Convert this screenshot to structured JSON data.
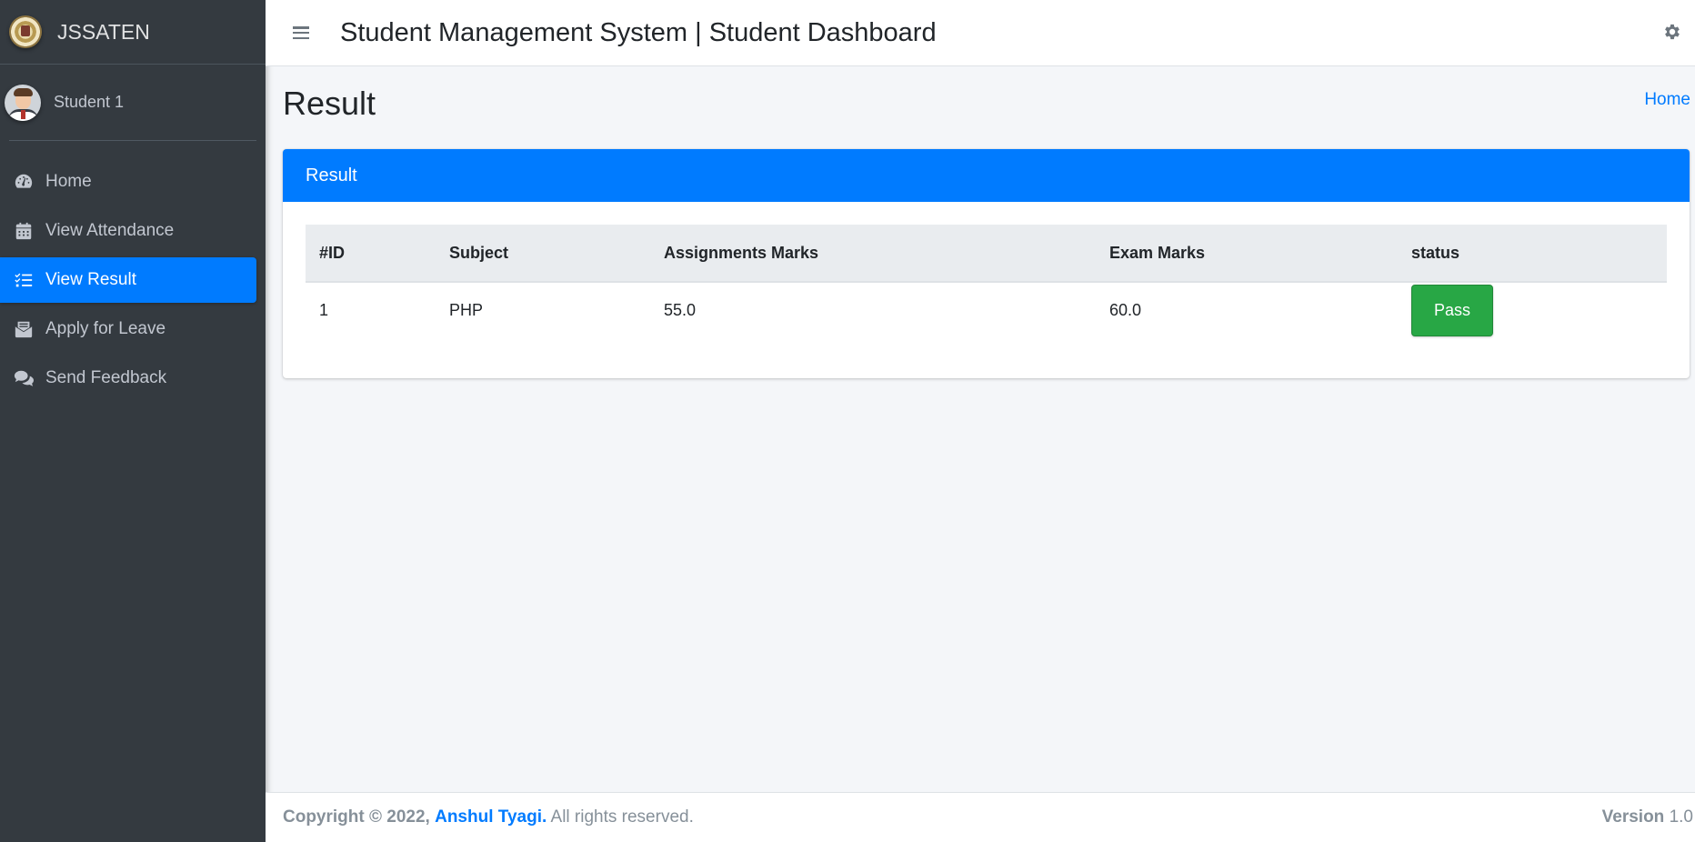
{
  "brand": {
    "name": "JSSATEN"
  },
  "user": {
    "name": "Student 1"
  },
  "sidebar": {
    "items": [
      {
        "label": "Home",
        "icon": "tachometer-icon",
        "active": false
      },
      {
        "label": "View Attendance",
        "icon": "calendar-icon",
        "active": false
      },
      {
        "label": "View Result",
        "icon": "tasks-icon",
        "active": true
      },
      {
        "label": "Apply for Leave",
        "icon": "envelope-open-icon",
        "active": false
      },
      {
        "label": "Send Feedback",
        "icon": "comments-icon",
        "active": false
      }
    ]
  },
  "header": {
    "title": "Student Management System | Student Dashboard"
  },
  "content": {
    "page_title": "Result",
    "breadcrumb": "Home"
  },
  "card": {
    "title": "Result",
    "columns": [
      "#ID",
      "Subject",
      "Assignments Marks",
      "Exam Marks",
      "status"
    ],
    "rows": [
      {
        "id": "1",
        "subject": "PHP",
        "assignments": "55.0",
        "exam": "60.0",
        "status": "Pass"
      }
    ]
  },
  "footer": {
    "copyright_prefix": "Copyright © 2022,",
    "author": "Anshul Tyagi.",
    "rights": "All rights reserved.",
    "version_label": "Version",
    "version_value": "1.0"
  },
  "colors": {
    "sidebar_bg": "#343a40",
    "primary": "#007bff",
    "success": "#28a745",
    "content_bg": "#f4f6f9"
  }
}
